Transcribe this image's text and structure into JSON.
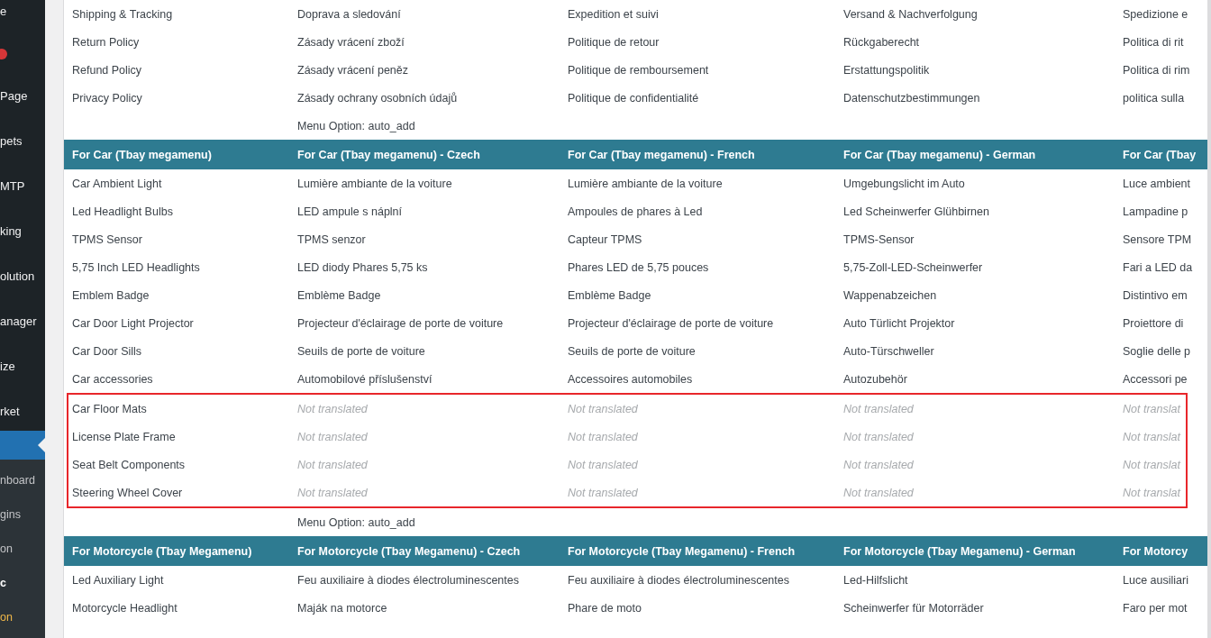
{
  "sidebar": {
    "items": [
      {
        "label": "e",
        "kind": "item"
      },
      {
        "kind": "badge"
      },
      {
        "label": "Page",
        "kind": "item"
      },
      {
        "label": "pets",
        "kind": "item"
      },
      {
        "label": "MTP",
        "kind": "item"
      },
      {
        "label": "king",
        "kind": "item"
      },
      {
        "label": "olution",
        "kind": "item"
      },
      {
        "label": "anager",
        "kind": "item"
      },
      {
        "label": "ize",
        "kind": "item"
      },
      {
        "label": "rket",
        "kind": "item"
      }
    ],
    "active_item": {
      "selected": true
    },
    "submenu": [
      {
        "label": "nboard",
        "kind": "normal"
      },
      {
        "label": "gins",
        "kind": "normal"
      },
      {
        "label": "on",
        "kind": "normal"
      },
      {
        "label": "c",
        "kind": "current"
      },
      {
        "label": "on",
        "kind": "accent"
      }
    ]
  },
  "sections": [
    {
      "rows": [
        {
          "cells": [
            {
              "text": "Shipping & Tracking",
              "kind": "text"
            },
            {
              "text": "Doprava a sledování",
              "kind": "text"
            },
            {
              "text": "Expedition et suivi",
              "kind": "text"
            },
            {
              "text": "Versand & Nachverfolgung",
              "kind": "text"
            },
            {
              "text": "Spedizione e",
              "kind": "text"
            }
          ]
        },
        {
          "cells": [
            {
              "text": "Return Policy",
              "kind": "text"
            },
            {
              "text": "Zásady vrácení zboží",
              "kind": "text"
            },
            {
              "text": "Politique de retour",
              "kind": "text"
            },
            {
              "text": "Rückgaberecht",
              "kind": "text"
            },
            {
              "text": "Politica di rit",
              "kind": "text"
            }
          ]
        },
        {
          "cells": [
            {
              "text": "Refund Policy",
              "kind": "text"
            },
            {
              "text": "Zásady vrácení peněz",
              "kind": "text"
            },
            {
              "text": "Politique de remboursement",
              "kind": "text"
            },
            {
              "text": "Erstattungspolitik",
              "kind": "text"
            },
            {
              "text": "Politica di rim",
              "kind": "text"
            }
          ]
        },
        {
          "cells": [
            {
              "text": "Privacy Policy",
              "kind": "text"
            },
            {
              "text": "Zásady ochrany osobních údajů",
              "kind": "text"
            },
            {
              "text": "Politique de confidentialité",
              "kind": "text"
            },
            {
              "text": "Datenschutzbestimmungen",
              "kind": "text"
            },
            {
              "text": "politica sulla",
              "kind": "text"
            }
          ]
        },
        {
          "option": "Menu Option: auto_add"
        }
      ]
    },
    {
      "header": [
        "For Car (Tbay megamenu)",
        "For Car (Tbay megamenu) - Czech",
        "For Car (Tbay megamenu) - French",
        "For Car (Tbay megamenu) - German",
        "For Car (Tbay"
      ],
      "rows": [
        {
          "cells": [
            {
              "text": "Car Ambient Light",
              "kind": "text"
            },
            {
              "text": "Lumière ambiante de la voiture",
              "kind": "text"
            },
            {
              "text": "Lumière ambiante de la voiture",
              "kind": "text"
            },
            {
              "text": "Umgebungslicht im Auto",
              "kind": "text"
            },
            {
              "text": "Luce ambient",
              "kind": "text"
            }
          ]
        },
        {
          "cells": [
            {
              "text": "Led Headlight Bulbs",
              "kind": "text"
            },
            {
              "text": "LED ampule s náplní",
              "kind": "text"
            },
            {
              "text": "Ampoules de phares à Led",
              "kind": "text"
            },
            {
              "text": "Led Scheinwerfer Glühbirnen",
              "kind": "text"
            },
            {
              "text": "Lampadine p",
              "kind": "text"
            }
          ]
        },
        {
          "cells": [
            {
              "text": "TPMS Sensor",
              "kind": "text"
            },
            {
              "text": "TPMS senzor",
              "kind": "text"
            },
            {
              "text": "Capteur TPMS",
              "kind": "text"
            },
            {
              "text": "TPMS-Sensor",
              "kind": "text"
            },
            {
              "text": "Sensore TPM",
              "kind": "text"
            }
          ]
        },
        {
          "cells": [
            {
              "text": "5,75 Inch LED Headlights",
              "kind": "text"
            },
            {
              "text": "LED diody Phares 5,75 ks",
              "kind": "text"
            },
            {
              "text": "Phares LED de 5,75 pouces",
              "kind": "text"
            },
            {
              "text": "5,75-Zoll-LED-Scheinwerfer",
              "kind": "text"
            },
            {
              "text": "Fari a LED da",
              "kind": "text"
            }
          ]
        },
        {
          "cells": [
            {
              "text": "Emblem Badge",
              "kind": "text"
            },
            {
              "text": "Emblème Badge",
              "kind": "text"
            },
            {
              "text": "Emblème Badge",
              "kind": "text"
            },
            {
              "text": "Wappenabzeichen",
              "kind": "text"
            },
            {
              "text": "Distintivo em",
              "kind": "text"
            }
          ]
        },
        {
          "cells": [
            {
              "text": "Car Door Light Projector",
              "kind": "text"
            },
            {
              "text": "Projecteur d'éclairage de porte de voiture",
              "kind": "text"
            },
            {
              "text": "Projecteur d'éclairage de porte de voiture",
              "kind": "text"
            },
            {
              "text": "Auto Türlicht Projektor",
              "kind": "text"
            },
            {
              "text": "Proiettore di",
              "kind": "text"
            }
          ]
        },
        {
          "cells": [
            {
              "text": "Car Door Sills",
              "kind": "text"
            },
            {
              "text": "Seuils de porte de voiture",
              "kind": "text"
            },
            {
              "text": "Seuils de porte de voiture",
              "kind": "text"
            },
            {
              "text": "Auto-Türschweller",
              "kind": "text"
            },
            {
              "text": "Soglie delle p",
              "kind": "text"
            }
          ]
        },
        {
          "cells": [
            {
              "text": "Car accessories",
              "kind": "text"
            },
            {
              "text": "Automobilové příslušenství",
              "kind": "text"
            },
            {
              "text": "Accessoires automobiles",
              "kind": "text"
            },
            {
              "text": "Autozubehör",
              "kind": "text"
            },
            {
              "text": "Accessori pe",
              "kind": "text"
            }
          ]
        },
        {
          "highlighted": true,
          "cells": [
            {
              "text": "Car Floor Mats",
              "kind": "text"
            },
            {
              "text": "Not translated",
              "kind": "untranslated"
            },
            {
              "text": "Not translated",
              "kind": "untranslated"
            },
            {
              "text": "Not translated",
              "kind": "untranslated"
            },
            {
              "text": "Not translat",
              "kind": "untranslated"
            }
          ]
        },
        {
          "highlighted": true,
          "cells": [
            {
              "text": "License Plate Frame",
              "kind": "text"
            },
            {
              "text": "Not translated",
              "kind": "untranslated"
            },
            {
              "text": "Not translated",
              "kind": "untranslated"
            },
            {
              "text": "Not translated",
              "kind": "untranslated"
            },
            {
              "text": "Not translat",
              "kind": "untranslated"
            }
          ]
        },
        {
          "highlighted": true,
          "cells": [
            {
              "text": "Seat Belt Components",
              "kind": "text"
            },
            {
              "text": "Not translated",
              "kind": "untranslated"
            },
            {
              "text": "Not translated",
              "kind": "untranslated"
            },
            {
              "text": "Not translated",
              "kind": "untranslated"
            },
            {
              "text": "Not translat",
              "kind": "untranslated"
            }
          ]
        },
        {
          "highlighted": true,
          "cells": [
            {
              "text": "Steering Wheel Cover",
              "kind": "text"
            },
            {
              "text": "Not translated",
              "kind": "untranslated"
            },
            {
              "text": "Not translated",
              "kind": "untranslated"
            },
            {
              "text": "Not translated",
              "kind": "untranslated"
            },
            {
              "text": "Not translat",
              "kind": "untranslated"
            }
          ]
        },
        {
          "option": "Menu Option: auto_add"
        }
      ]
    },
    {
      "header": [
        "For Motorcycle (Tbay Megamenu)",
        "For Motorcycle (Tbay Megamenu) - Czech",
        "For Motorcycle (Tbay Megamenu) - French",
        "For Motorcycle (Tbay Megamenu) - German",
        "For Motorcy"
      ],
      "rows": [
        {
          "cells": [
            {
              "text": "Led Auxiliary Light",
              "kind": "text"
            },
            {
              "text": "Feu auxiliaire à diodes électroluminescentes",
              "kind": "text"
            },
            {
              "text": "Feu auxiliaire à diodes électroluminescentes",
              "kind": "text"
            },
            {
              "text": "Led-Hilfslicht",
              "kind": "text"
            },
            {
              "text": "Luce ausiliari",
              "kind": "text"
            }
          ]
        },
        {
          "cells": [
            {
              "text": "Motorcycle Headlight",
              "kind": "text"
            },
            {
              "text": "Maják na motorce",
              "kind": "text"
            },
            {
              "text": "Phare de moto",
              "kind": "text"
            },
            {
              "text": "Scheinwerfer für Motorräder",
              "kind": "text"
            },
            {
              "text": "Faro per mot",
              "kind": "text"
            }
          ]
        }
      ]
    }
  ]
}
